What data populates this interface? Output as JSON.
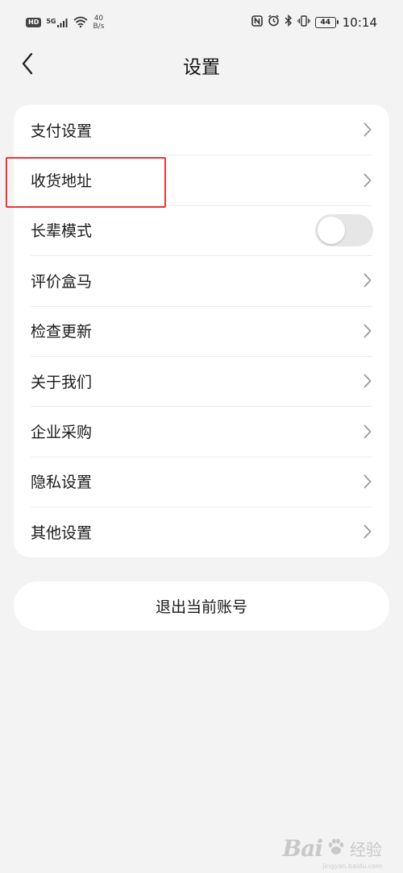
{
  "status_bar": {
    "left": {
      "hd_badge": "HD",
      "signal_label": "5G",
      "net_speed_value": "40",
      "net_speed_unit": "B/s"
    },
    "right": {
      "icons": [
        "nfc-icon",
        "alarm-icon",
        "bluetooth-icon",
        "vibrate-icon"
      ],
      "battery_level": "44",
      "time": "10:14"
    }
  },
  "header": {
    "title": "设置"
  },
  "settings": {
    "items": [
      {
        "label": "支付设置",
        "control": "chevron"
      },
      {
        "label": "收货地址",
        "control": "chevron",
        "highlighted": true
      },
      {
        "label": "长辈模式",
        "control": "toggle",
        "toggle_on": false
      },
      {
        "label": "评价盒马",
        "control": "chevron"
      },
      {
        "label": "检查更新",
        "control": "chevron"
      },
      {
        "label": "关于我们",
        "control": "chevron"
      },
      {
        "label": "企业采购",
        "control": "chevron"
      },
      {
        "label": "隐私设置",
        "control": "chevron"
      },
      {
        "label": "其他设置",
        "control": "chevron"
      }
    ]
  },
  "logout": {
    "label": "退出当前账号"
  },
  "watermark": {
    "text": "Bai",
    "sub": "经验",
    "url": "jingyan.baidu.com"
  },
  "colors": {
    "background": "#f3f3f3",
    "card": "#ffffff",
    "highlight": "#e53935"
  }
}
